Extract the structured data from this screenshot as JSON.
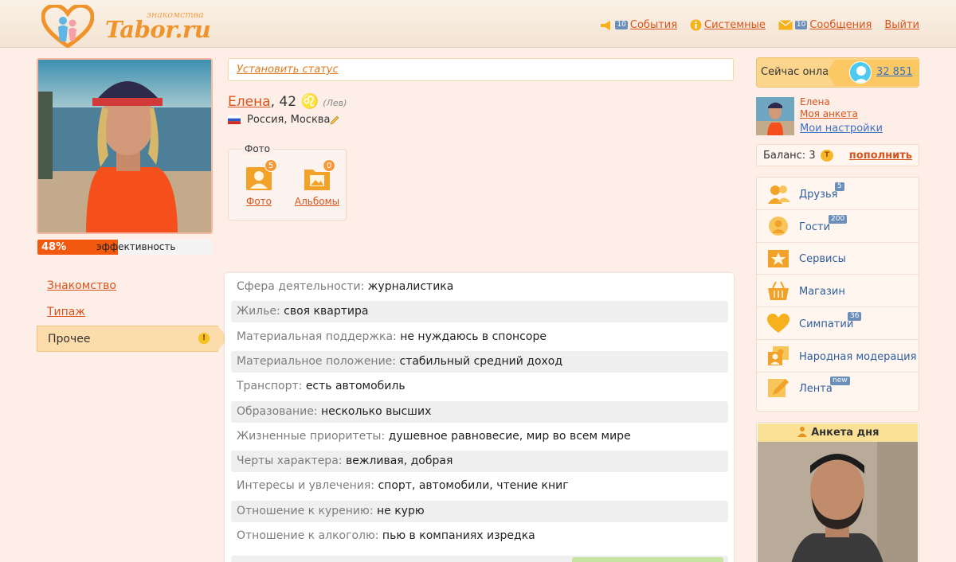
{
  "header": {
    "logo_text": "Tabor.ru",
    "logo_subtitle": "знакомства",
    "nav": [
      {
        "label": "События",
        "badge": "10",
        "icon": "megaphone-icon"
      },
      {
        "label": "Системные",
        "badge": "",
        "icon": "info-icon"
      },
      {
        "label": "Сообщения",
        "badge": "10",
        "icon": "envelope-icon"
      },
      {
        "label": "Выйти",
        "badge": "",
        "icon": ""
      }
    ]
  },
  "profile": {
    "effectiveness_percent": "48%",
    "effectiveness_value": 0.48,
    "effectiveness_label": "эффективность",
    "status_placeholder": "Установить статус",
    "name": "Елена",
    "age": ", 42",
    "zodiac_symbol": "♌",
    "zodiac_name": "(Лев)",
    "location": "Россия, Москва",
    "photos_label": "Фото",
    "photos": [
      {
        "label": "Фото",
        "count": "5"
      },
      {
        "label": "Альбомы",
        "count": "0"
      }
    ]
  },
  "left_menu": [
    {
      "label": "Знакомство",
      "active": false
    },
    {
      "label": "Типаж",
      "active": false
    },
    {
      "label": "Прочее",
      "active": true
    }
  ],
  "info": [
    {
      "key": "Сфера деятельности:",
      "value": "журналистика"
    },
    {
      "key": "Жилье:",
      "value": "своя квартира"
    },
    {
      "key": "Материальная поддержка:",
      "value": "не нуждаюсь в спонсоре"
    },
    {
      "key": "Материальное положение:",
      "value": "стабильный средний доход"
    },
    {
      "key": "Транспорт:",
      "value": "есть автомобиль"
    },
    {
      "key": "Образование:",
      "value": "несколько высших"
    },
    {
      "key": "Жизненные приоритеты:",
      "value": "душевное равновесие, мир во всем мире"
    },
    {
      "key": "Черты характера:",
      "value": "вежливая, добрая"
    },
    {
      "key": "Интересы и увлечения:",
      "value": "спорт, автомобили, чтение книг"
    },
    {
      "key": "Отношение к курению:",
      "value": "не курю"
    },
    {
      "key": "Отношение к алкоголю:",
      "value": "пью в компаниях изредка"
    }
  ],
  "sidebar": {
    "online_label": "Сейчас онлайн:",
    "online_count": "32 851",
    "me_name": "Елена",
    "my_profile": "Моя анкета",
    "my_settings": "Мои настройки",
    "balance_label": "Баланс: 3",
    "coin_symbol": "T",
    "topup": "пополнить",
    "services": [
      {
        "label": "Друзья",
        "badge": "5",
        "icon": "friends-icon"
      },
      {
        "label": "Гости",
        "badge": "200",
        "icon": "guests-icon"
      },
      {
        "label": "Сервисы",
        "badge": "",
        "icon": "star-icon"
      },
      {
        "label": "Магазин",
        "badge": "",
        "icon": "basket-icon"
      },
      {
        "label": "Симпатии",
        "badge": "36",
        "icon": "heart-icon"
      },
      {
        "label": "Народная модерация",
        "badge": "",
        "icon": "moderation-icon"
      },
      {
        "label": "Лента",
        "badge": "new",
        "icon": "pencil-icon"
      }
    ],
    "profile_of_day": "Анкета дня"
  },
  "colors": {
    "accent": "#d9541c",
    "orange": "#f2590f",
    "link_blue": "#3d73c2",
    "background": "#fdeee8"
  }
}
